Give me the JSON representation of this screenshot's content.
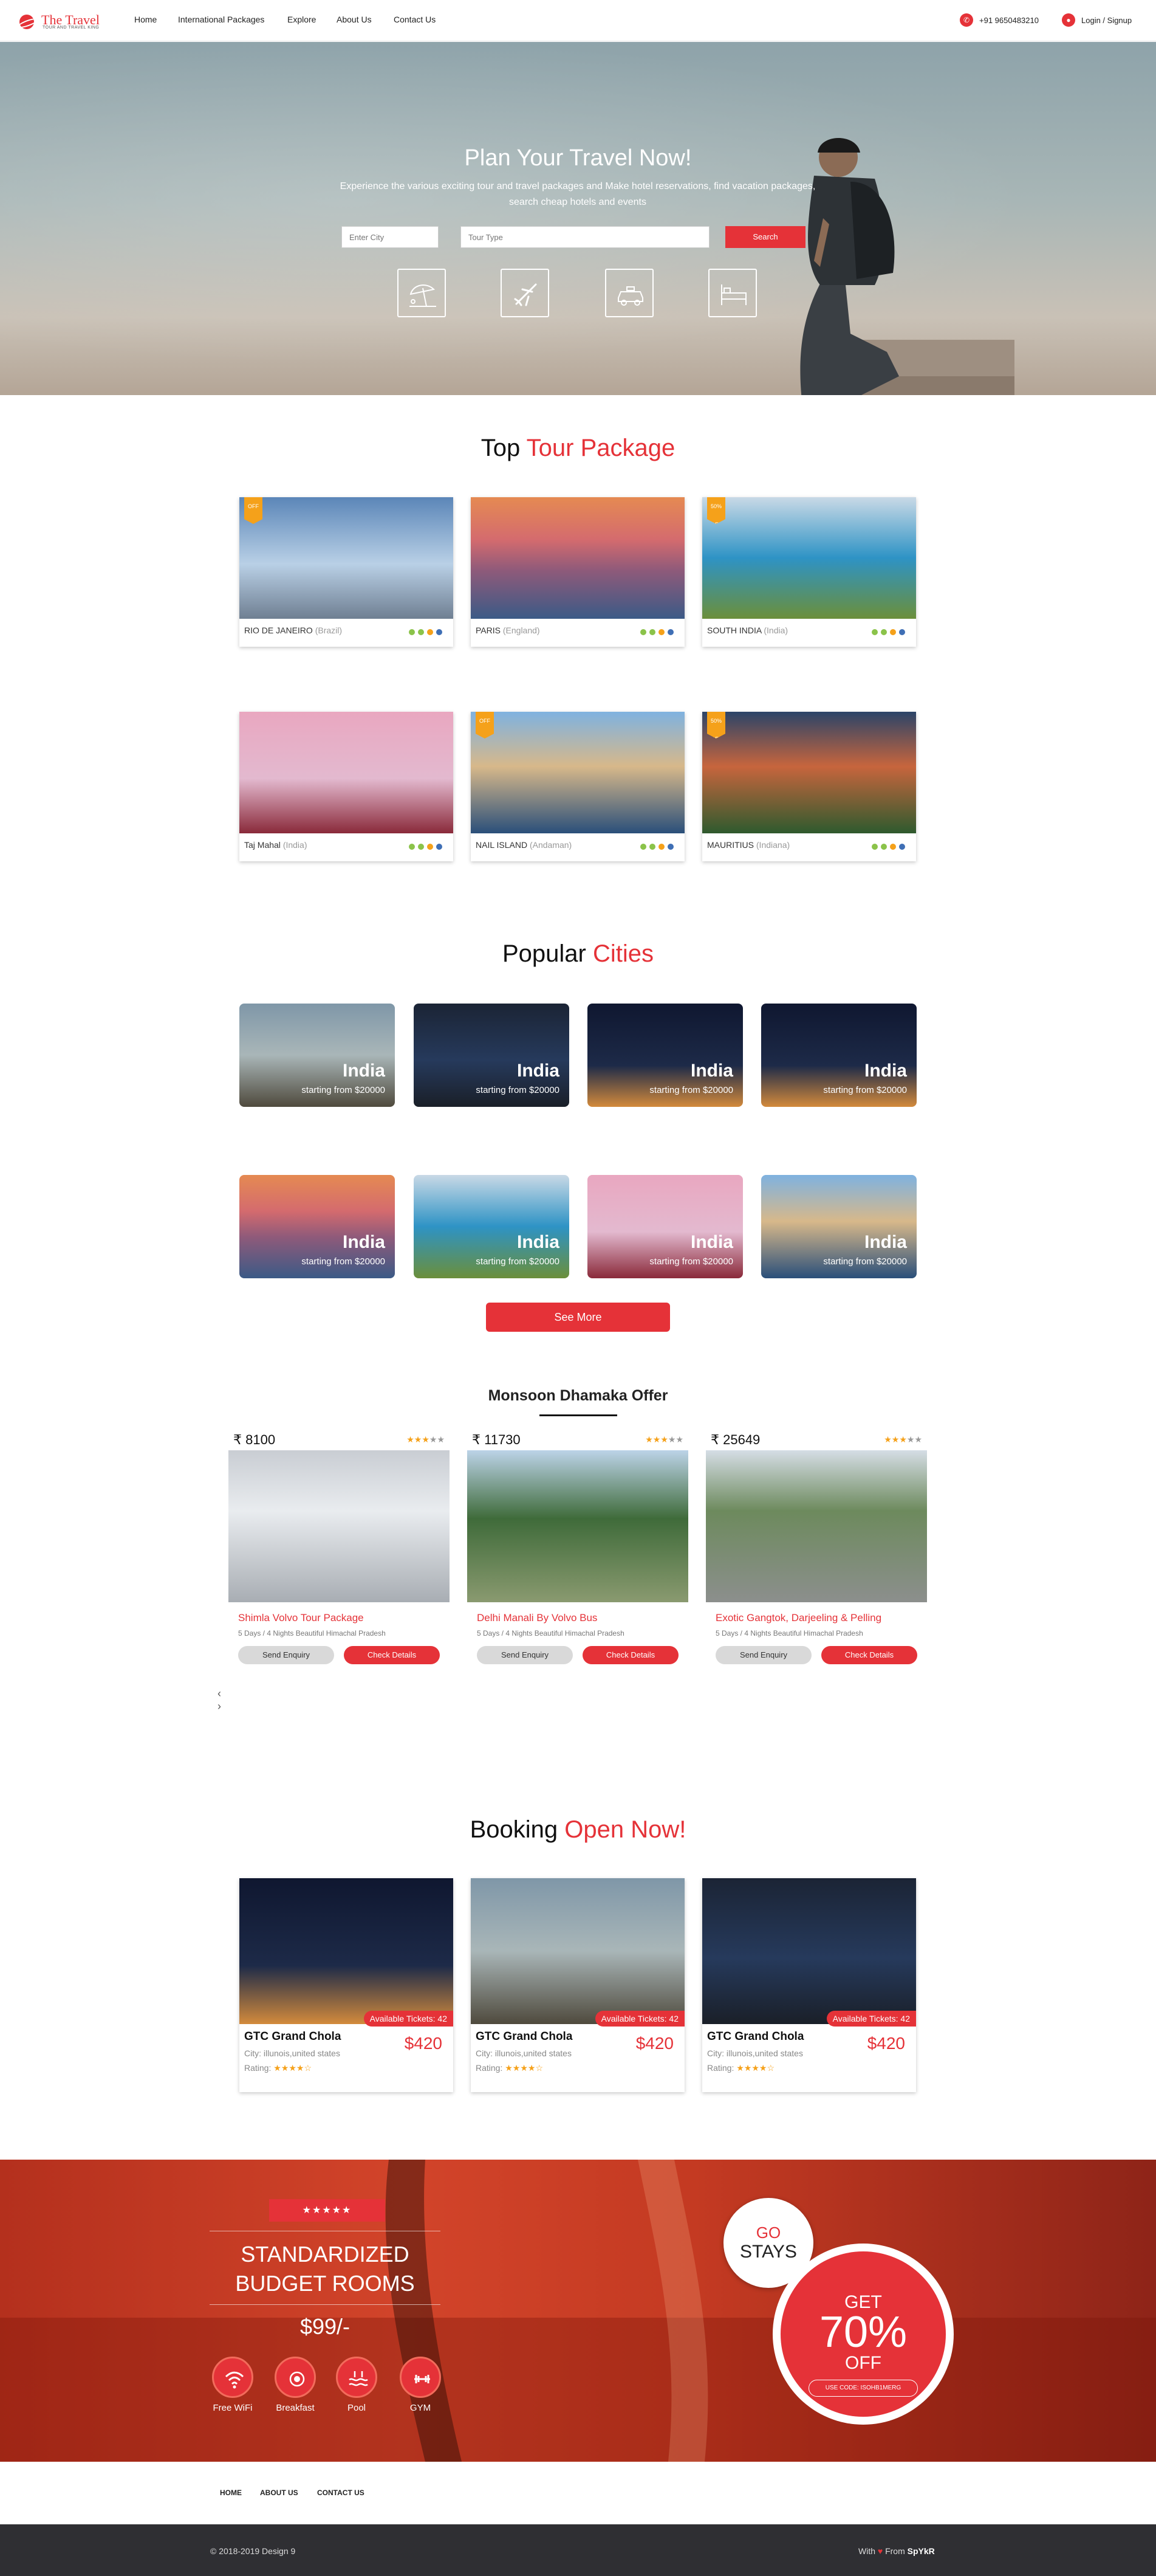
{
  "header": {
    "logo_title": "The Travel",
    "logo_subtitle": "TOUR AND TRAVEL KING",
    "nav": [
      "Home",
      "International Packages",
      "Explore",
      "About Us",
      "Contact Us"
    ],
    "phone": "+91 9650483210",
    "login": "Login / Signup"
  },
  "hero": {
    "title": "Plan Your Travel Now!",
    "subtitle": "Experience the various exciting tour and travel packages and Make hotel reservations, find vacation packages, search cheap hotels and events",
    "city_placeholder": "Enter City",
    "tour_placeholder": "Tour Type",
    "search_label": "Search",
    "services": [
      "beach-icon",
      "flight-icon",
      "taxi-icon",
      "hotel-bed-icon"
    ]
  },
  "packages": {
    "title_a": "Top",
    "title_b": "Tour Package",
    "items": [
      {
        "name": "RIO DE JANEIRO",
        "country": "(Brazil)",
        "badge": "OFF"
      },
      {
        "name": "PARIS",
        "country": "(England)",
        "badge": ""
      },
      {
        "name": "SOUTH INDIA",
        "country": "(India)",
        "badge": "50% OFF"
      },
      {
        "name": "Taj Mahal",
        "country": "(India)",
        "badge": ""
      },
      {
        "name": "NAIL ISLAND",
        "country": "(Andaman)",
        "badge": "OFF"
      },
      {
        "name": "MAURITIUS",
        "country": "(Indiana)",
        "badge": "50% OFF"
      }
    ],
    "dot_colors": [
      "#8bc34a",
      "#8bc34a",
      "#f5a11a",
      "#3f6fb5"
    ]
  },
  "cities": {
    "title_a": "Popular",
    "title_b": "Cities",
    "items": [
      {
        "name": "India",
        "price": "starting from $20000"
      },
      {
        "name": "India",
        "price": "starting from $20000"
      },
      {
        "name": "India",
        "price": "starting from $20000"
      },
      {
        "name": "India",
        "price": "starting from $20000"
      },
      {
        "name": "India",
        "price": "starting from $20000"
      },
      {
        "name": "India",
        "price": "starting from $20000"
      },
      {
        "name": "India",
        "price": "starting from $20000"
      },
      {
        "name": "India",
        "price": "starting from $20000"
      }
    ],
    "see_more": "See More"
  },
  "offer": {
    "title": "Monsoon Dhamaka Offer",
    "items": [
      {
        "price": "₹ 8100",
        "stars": "★★★★★",
        "title": "Shimla Volvo Tour Package",
        "desc": "5 Days / 4 Nights Beautiful Himachal Pradesh"
      },
      {
        "price": "₹ 11730",
        "stars": "★★★★★",
        "title": "Delhi Manali By Volvo Bus",
        "desc": "5 Days / 4 Nights Beautiful Himachal Pradesh"
      },
      {
        "price": "₹ 25649",
        "stars": "★★★★★",
        "title": "Exotic Gangtok, Darjeeling & Pelling",
        "desc": "5 Days / 4 Nights Beautiful Himachal Pradesh"
      }
    ],
    "enquiry_label": "Send Enquiry",
    "details_label": "Check Details",
    "prev": "‹",
    "next": "›"
  },
  "booking": {
    "title_a": "Booking",
    "title_b": "Open Now!",
    "items": [
      {
        "tickets": "Available Tickets: 42",
        "name": "GTC Grand Chola",
        "city": "City: illunois,united states",
        "rating": "Rating:",
        "stars": "★★★★☆",
        "price": "$420"
      },
      {
        "tickets": "Available Tickets: 42",
        "name": "GTC Grand Chola",
        "city": "City: illunois,united states",
        "rating": "Rating:",
        "stars": "★★★★☆",
        "price": "$420"
      },
      {
        "tickets": "Available Tickets: 42",
        "name": "GTC Grand Chola",
        "city": "City: illunois,united states",
        "rating": "Rating:",
        "stars": "★★★★☆",
        "price": "$420"
      }
    ]
  },
  "promo": {
    "stars": "★★★★★",
    "line1": "STANDARDIZED",
    "line2": "BUDGET ROOMS",
    "price": "$99/-",
    "amenities": [
      "Free WiFi",
      "Breakfast",
      "Pool",
      "GYM"
    ],
    "go": "GO",
    "stays": "STAYS",
    "get": "GET",
    "percent": "70%",
    "off": "OFF",
    "code": "USE CODE: ISOHB1MERG"
  },
  "footer": {
    "links": [
      "HOME",
      "ABOUT US",
      "CONTACT US"
    ],
    "copyright": "© 2018-2019 Design 9",
    "with": "With",
    "from": "From",
    "brand": "SpYkR"
  }
}
